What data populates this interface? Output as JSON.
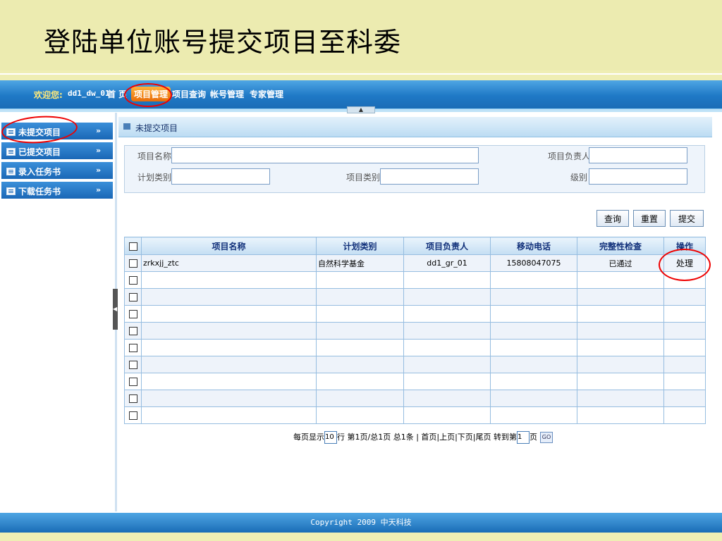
{
  "slide": {
    "title": "登陆单位账号提交项目至科委"
  },
  "topnav": {
    "welcome": "欢迎您:",
    "user": "dd1_dw_01",
    "links": [
      "首 页",
      "项目管理",
      "项目查询",
      "帐号管理",
      "专家管理"
    ]
  },
  "sidebar": {
    "items": [
      {
        "label": "未提交项目"
      },
      {
        "label": "已提交项目"
      },
      {
        "label": "录入任务书"
      },
      {
        "label": "下载任务书"
      }
    ],
    "chevron": "»"
  },
  "panel": {
    "title": "未提交项目"
  },
  "search": {
    "project_name_label": "项目名称",
    "leader_label": "项目负责人",
    "plan_category_label": "计划类别",
    "project_category_label": "项目类别",
    "level_label": "级别"
  },
  "buttons": {
    "query": "查询",
    "reset": "重置",
    "submit": "提交"
  },
  "table": {
    "headers": [
      "项目名称",
      "计划类别",
      "项目负责人",
      "移动电话",
      "完整性检查",
      "操作"
    ],
    "rows": [
      {
        "name": "zrkxjj_ztc",
        "plan": "自然科学基金",
        "leader": "dd1_gr_01",
        "phone": "15808047075",
        "check": "已通过",
        "action": "处理"
      }
    ],
    "empty_rows": 9
  },
  "pager": {
    "per_page_label": "每页显示",
    "per_page_value": "10",
    "summary": "行 第1页/总1页 总1条 | 首页|上页|下页|尾页 转到第",
    "page_value": "1",
    "page_suffix": "页",
    "go": "GO"
  },
  "footer": {
    "copyright": "Copyright 2009 中天科技"
  },
  "colors": {
    "annotation": "#e00000",
    "nav_blue": "#1f79c6",
    "active_tab": "#f08a1c"
  }
}
